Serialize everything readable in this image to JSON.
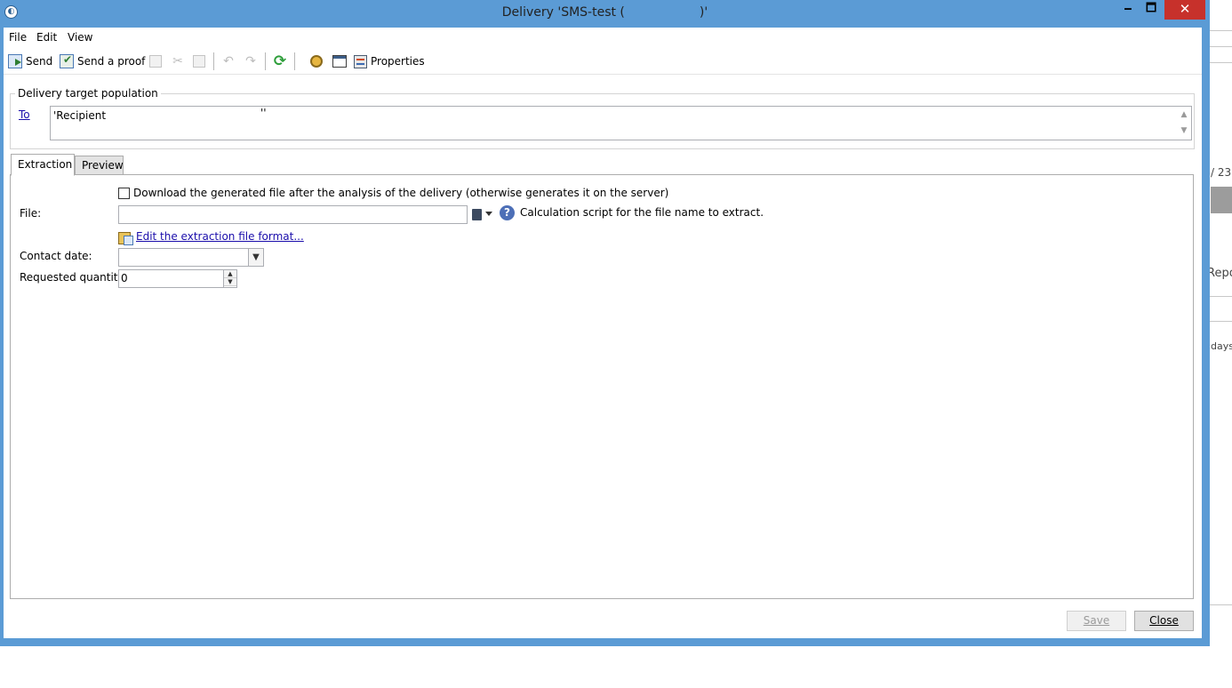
{
  "window": {
    "title_prefix": "Delivery 'SMS-test (",
    "title_suffix": ")'",
    "minimize_label": "🗕",
    "maximize_label": "🗖",
    "close_label": "✕"
  },
  "menubar": {
    "items": [
      "File",
      "Edit",
      "View"
    ]
  },
  "toolbar": {
    "send_label": "Send",
    "send_proof_label": "Send a proof",
    "properties_label": "Properties"
  },
  "target": {
    "legend": "Delivery target population",
    "to_label": "To",
    "to_value": "'Recipient",
    "to_value_end": "''"
  },
  "tabs": [
    "Extraction",
    "Preview"
  ],
  "extraction": {
    "download_checkbox_label": "Download the generated file after the analysis of the delivery (otherwise generates it on the server)",
    "download_checked": false,
    "file_label": "File:",
    "file_value": "",
    "help_text": "Calculation script for the file name to extract.",
    "edit_format_link": "Edit the extraction file format...",
    "contact_date_label": "Contact date:",
    "contact_date_value": "",
    "requested_quantity_label": "Requested quantity:",
    "requested_quantity_value": "0"
  },
  "footer": {
    "save_label": "Save",
    "close_label": "Close"
  },
  "background_app": {
    "page_text": "/ 23",
    "repo_text": "Repo",
    "days_text": "days"
  },
  "colors": {
    "titlebar": "#5b9bd5",
    "close_button": "#c7312b",
    "link": "#1a0dab"
  }
}
